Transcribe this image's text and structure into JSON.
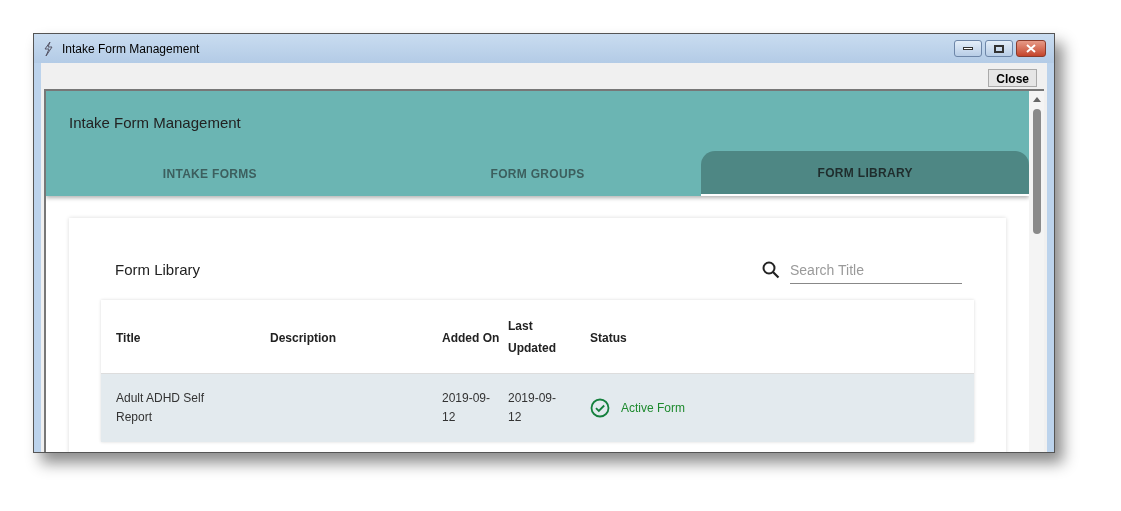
{
  "window": {
    "title": "Intake Form Management"
  },
  "toolbar": {
    "close_button": "Close"
  },
  "header": {
    "title": "Intake Form Management"
  },
  "tabs": [
    {
      "label": "INTAKE FORMS",
      "selected": false
    },
    {
      "label": "FORM GROUPS",
      "selected": false
    },
    {
      "label": "FORM LIBRARY",
      "selected": true
    }
  ],
  "card": {
    "title": "Form Library",
    "search": {
      "placeholder": "Search Title"
    }
  },
  "table": {
    "columns": [
      "Title",
      "Description",
      "Added On",
      "Last Updated",
      "Status"
    ],
    "rows": [
      {
        "title": "Adult ADHD Self Report",
        "added_on": "2019-09-12",
        "last_updated": "2019-09-12",
        "status": {
          "kind": "active",
          "text": "Active Form"
        }
      }
    ]
  }
}
